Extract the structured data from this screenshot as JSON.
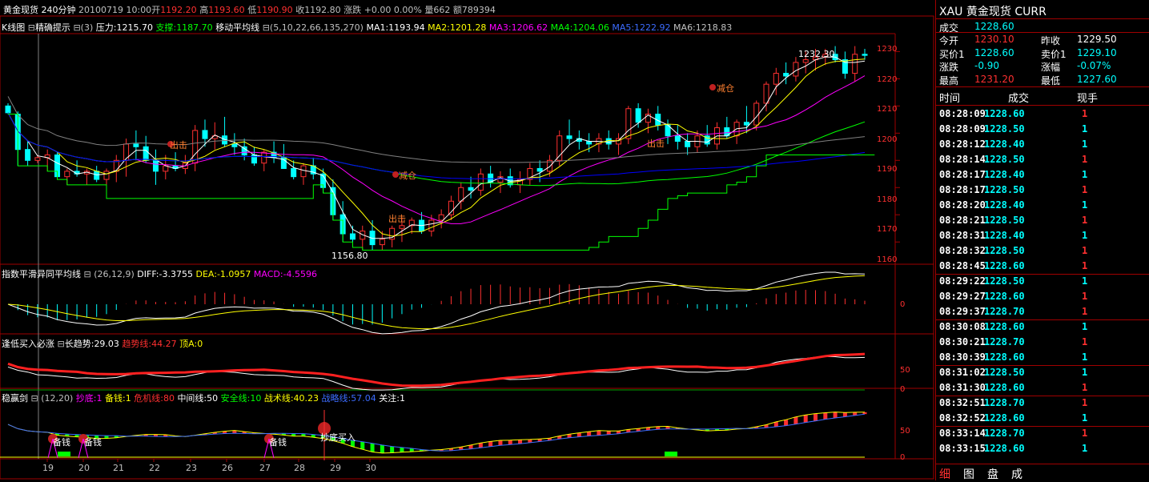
{
  "header": {
    "name": "黄金现货",
    "period": "240分钟",
    "date": "20100719 10:00",
    "open_label": "开",
    "open": "1192.20",
    "high_label": "高",
    "high": "1193.60",
    "low_label": "低",
    "low": "1190.90",
    "close_label": "收",
    "close": "1192.80",
    "change_label": "涨跌",
    "change": "+0.00",
    "pct": "0.00%",
    "vol_label": "量",
    "vol": "662",
    "amt_label": "额",
    "amt": "789394"
  },
  "main_panel": {
    "title": "K线图",
    "sub": "精确提示",
    "p1": "(3)",
    "press_label": "压力:",
    "press": "1215.70",
    "support_label": "支撑:",
    "support": "1187.70",
    "ma_title": "移动平均线",
    "ma_params": "(5,10,22,66,135,270)",
    "ma1": "MA1:1193.94",
    "ma2": "MA2:1201.28",
    "ma3": "MA3:1206.62",
    "ma4": "MA4:1204.06",
    "ma5": "MA5:1222.92",
    "ma6": "MA6:1218.83",
    "high_mark": "1232.30",
    "low_mark": "1156.80",
    "ann1": "出击",
    "ann2": "减仓",
    "ann3": "出击",
    "ann4": "出击",
    "ann5": "减仓"
  },
  "macd_panel": {
    "title": "指数平滑异同平均线",
    "params": "(26,12,9)",
    "diff": "DIFF:-3.3755",
    "dea": "DEA:-1.0957",
    "macd": "MACD:-4.5596",
    "axis_zero": "0"
  },
  "trend_panel": {
    "title": "逢低买入必涨",
    "long_label": "长趋势:",
    "long": "29.03",
    "trend_label": "趋势线:",
    "trend": "44.27",
    "top_label": "顶A:",
    "top": "0",
    "axis": [
      "50",
      "0"
    ]
  },
  "win_panel": {
    "title": "稳赢剑",
    "params": "(12,20)",
    "f1": "抄底:1",
    "f2": "备钱:1",
    "f3": "危机线:80",
    "f4": "中间线:50",
    "f5": "安全线:10",
    "f6": "战术线:40.23",
    "f7": "战略线:57.04",
    "f8": "关注:1",
    "ann_money": "备钱",
    "ann_buy": "抄底买入",
    "axis": [
      "50",
      "0"
    ]
  },
  "x_ticks": [
    "19",
    "20",
    "21",
    "22",
    "23",
    "26",
    "27",
    "28",
    "29",
    "30"
  ],
  "chart_data": {
    "type": "candlestick",
    "title": "黄金现货 240分钟",
    "ylim": [
      1153,
      1236
    ],
    "yticks": [
      1160,
      1170,
      1180,
      1190,
      1200,
      1210,
      1220,
      1230
    ],
    "candles": [
      [
        1210,
        1211,
        1207,
        1207.5
      ],
      [
        1207,
        1208,
        1188,
        1194
      ],
      [
        1194,
        1197,
        1188,
        1190
      ],
      [
        1190,
        1192,
        1189,
        1191
      ],
      [
        1191,
        1194,
        1186,
        1192
      ],
      [
        1192,
        1193,
        1183,
        1184
      ],
      [
        1184,
        1187,
        1181,
        1186
      ],
      [
        1186,
        1190,
        1184,
        1185
      ],
      [
        1185,
        1187,
        1181,
        1186
      ],
      [
        1186,
        1188,
        1182,
        1183
      ],
      [
        1183,
        1187,
        1176,
        1186
      ],
      [
        1186,
        1192,
        1182,
        1190
      ],
      [
        1190,
        1198,
        1184,
        1196
      ],
      [
        1196,
        1201,
        1190,
        1195
      ],
      [
        1195,
        1199,
        1189,
        1190
      ],
      [
        1190,
        1194,
        1181,
        1186
      ],
      [
        1186,
        1192,
        1183,
        1188
      ],
      [
        1188,
        1193,
        1186,
        1187
      ],
      [
        1187,
        1192,
        1185,
        1189
      ],
      [
        1189,
        1203,
        1186,
        1201
      ],
      [
        1201,
        1205,
        1195,
        1198
      ],
      [
        1198,
        1204,
        1194,
        1199
      ],
      [
        1199,
        1206,
        1195,
        1196
      ],
      [
        1196,
        1200,
        1192,
        1195
      ],
      [
        1195,
        1198,
        1190,
        1192
      ],
      [
        1192,
        1195,
        1188,
        1189
      ],
      [
        1189,
        1194,
        1186,
        1193
      ],
      [
        1193,
        1197,
        1189,
        1191
      ],
      [
        1191,
        1196,
        1188,
        1187
      ],
      [
        1187,
        1190,
        1183,
        1184
      ],
      [
        1184,
        1189,
        1181,
        1188
      ],
      [
        1188,
        1191,
        1183,
        1185
      ],
      [
        1185,
        1187,
        1178,
        1180
      ],
      [
        1180,
        1183,
        1168,
        1170
      ],
      [
        1170,
        1175,
        1160,
        1163
      ],
      [
        1163,
        1166,
        1158,
        1161
      ],
      [
        1161,
        1166,
        1157,
        1164
      ],
      [
        1164,
        1168,
        1157,
        1159
      ],
      [
        1159,
        1164,
        1157,
        1161
      ],
      [
        1161,
        1166,
        1158,
        1165
      ],
      [
        1165,
        1169,
        1160,
        1166
      ],
      [
        1166,
        1169,
        1163,
        1168
      ],
      [
        1168,
        1171,
        1163,
        1164
      ],
      [
        1164,
        1170,
        1162,
        1168
      ],
      [
        1168,
        1172,
        1165,
        1170
      ],
      [
        1170,
        1177,
        1168,
        1175
      ],
      [
        1175,
        1182,
        1172,
        1180
      ],
      [
        1180,
        1184,
        1176,
        1179
      ],
      [
        1179,
        1187,
        1177,
        1185
      ],
      [
        1185,
        1188,
        1180,
        1182
      ],
      [
        1182,
        1186,
        1178,
        1184
      ],
      [
        1184,
        1187,
        1180,
        1181
      ],
      [
        1181,
        1186,
        1178,
        1183
      ],
      [
        1183,
        1189,
        1181,
        1187
      ],
      [
        1187,
        1190,
        1182,
        1186
      ],
      [
        1186,
        1192,
        1184,
        1190
      ],
      [
        1190,
        1201,
        1188,
        1199
      ],
      [
        1199,
        1205,
        1196,
        1198
      ],
      [
        1198,
        1201,
        1194,
        1197
      ],
      [
        1197,
        1200,
        1193,
        1196
      ],
      [
        1196,
        1200,
        1193,
        1198
      ],
      [
        1198,
        1201,
        1194,
        1196
      ],
      [
        1196,
        1200,
        1192,
        1198
      ],
      [
        1198,
        1210,
        1196,
        1209
      ],
      [
        1209,
        1211,
        1202,
        1204
      ],
      [
        1204,
        1209,
        1200,
        1207
      ],
      [
        1207,
        1210,
        1201,
        1203
      ],
      [
        1203,
        1205,
        1196,
        1199
      ],
      [
        1199,
        1203,
        1194,
        1197
      ],
      [
        1197,
        1200,
        1192,
        1195
      ],
      [
        1195,
        1201,
        1193,
        1199
      ],
      [
        1199,
        1203,
        1195,
        1196
      ],
      [
        1196,
        1204,
        1194,
        1202
      ],
      [
        1202,
        1206,
        1198,
        1199
      ],
      [
        1199,
        1205,
        1196,
        1204
      ],
      [
        1204,
        1210,
        1200,
        1203
      ],
      [
        1203,
        1212,
        1201,
        1211
      ],
      [
        1211,
        1219,
        1208,
        1218
      ],
      [
        1218,
        1224,
        1214,
        1222
      ],
      [
        1222,
        1226,
        1218,
        1221
      ],
      [
        1221,
        1228,
        1219,
        1226
      ],
      [
        1226,
        1230,
        1222,
        1227
      ],
      [
        1227,
        1231,
        1223,
        1228
      ],
      [
        1228,
        1231,
        1225,
        1229
      ],
      [
        1229,
        1232,
        1226,
        1227
      ],
      [
        1227,
        1230,
        1220,
        1222
      ],
      [
        1222,
        1232,
        1219,
        1229
      ],
      [
        1229,
        1231,
        1227,
        1228.6
      ]
    ],
    "ma_colors": {
      "MA1": "#ffffff",
      "MA2": "#ffff00",
      "MA3": "#ff00ff",
      "MA4": "#00ff00",
      "MA5": "#0000ff",
      "MA6": "#808080"
    }
  },
  "quote": {
    "title": "XAU  黄金现货   CURR",
    "last_label": "成交",
    "last": "1228.60",
    "open_label": "今开",
    "open": "1230.10",
    "prev_label": "昨收",
    "prev": "1229.50",
    "bid_label": "买价1",
    "bid": "1228.60",
    "ask_label": "卖价1",
    "ask": "1229.10",
    "chg_label": "涨跌",
    "chg": "-0.90",
    "chgp_label": "涨幅",
    "chgp": "-0.07%",
    "hi_label": "最高",
    "hi": "1231.20",
    "lo_label": "最低",
    "lo": "1227.60"
  },
  "ticks_header": {
    "time": "时间",
    "price": "成交",
    "vol": "现手"
  },
  "ticks": [
    {
      "t": "08:28:09",
      "p": "1228.60",
      "v": "1",
      "c": "red"
    },
    {
      "t": "08:28:09",
      "p": "1228.50",
      "v": "1",
      "c": "cyan"
    },
    {
      "t": "08:28:12",
      "p": "1228.40",
      "v": "1",
      "c": "cyan"
    },
    {
      "t": "08:28:14",
      "p": "1228.50",
      "v": "1",
      "c": "red"
    },
    {
      "t": "08:28:17",
      "p": "1228.40",
      "v": "1",
      "c": "cyan"
    },
    {
      "t": "08:28:17",
      "p": "1228.50",
      "v": "1",
      "c": "red"
    },
    {
      "t": "08:28:20",
      "p": "1228.40",
      "v": "1",
      "c": "cyan"
    },
    {
      "t": "08:28:21",
      "p": "1228.50",
      "v": "1",
      "c": "red"
    },
    {
      "t": "08:28:31",
      "p": "1228.40",
      "v": "1",
      "c": "cyan"
    },
    {
      "t": "08:28:32",
      "p": "1228.50",
      "v": "1",
      "c": "red"
    },
    {
      "t": "08:28:45",
      "p": "1228.60",
      "v": "1",
      "c": "red"
    },
    {
      "t": "08:29:22",
      "p": "1228.50",
      "v": "1",
      "c": "cyan"
    },
    {
      "t": "08:29:27",
      "p": "1228.60",
      "v": "1",
      "c": "red"
    },
    {
      "t": "08:29:37",
      "p": "1228.70",
      "v": "1",
      "c": "red"
    },
    {
      "t": "08:30:08",
      "p": "1228.60",
      "v": "1",
      "c": "cyan"
    },
    {
      "t": "08:30:21",
      "p": "1228.70",
      "v": "1",
      "c": "red"
    },
    {
      "t": "08:30:39",
      "p": "1228.60",
      "v": "1",
      "c": "cyan"
    },
    {
      "t": "08:31:02",
      "p": "1228.50",
      "v": "1",
      "c": "cyan"
    },
    {
      "t": "08:31:30",
      "p": "1228.60",
      "v": "1",
      "c": "red"
    },
    {
      "t": "08:32:51",
      "p": "1228.70",
      "v": "1",
      "c": "red"
    },
    {
      "t": "08:32:52",
      "p": "1228.60",
      "v": "1",
      "c": "cyan"
    },
    {
      "t": "08:33:14",
      "p": "1228.70",
      "v": "1",
      "c": "red"
    },
    {
      "t": "08:33:15",
      "p": "1228.60",
      "v": "1",
      "c": "cyan"
    }
  ],
  "tabs": [
    "细",
    "图",
    "盘",
    "成"
  ]
}
